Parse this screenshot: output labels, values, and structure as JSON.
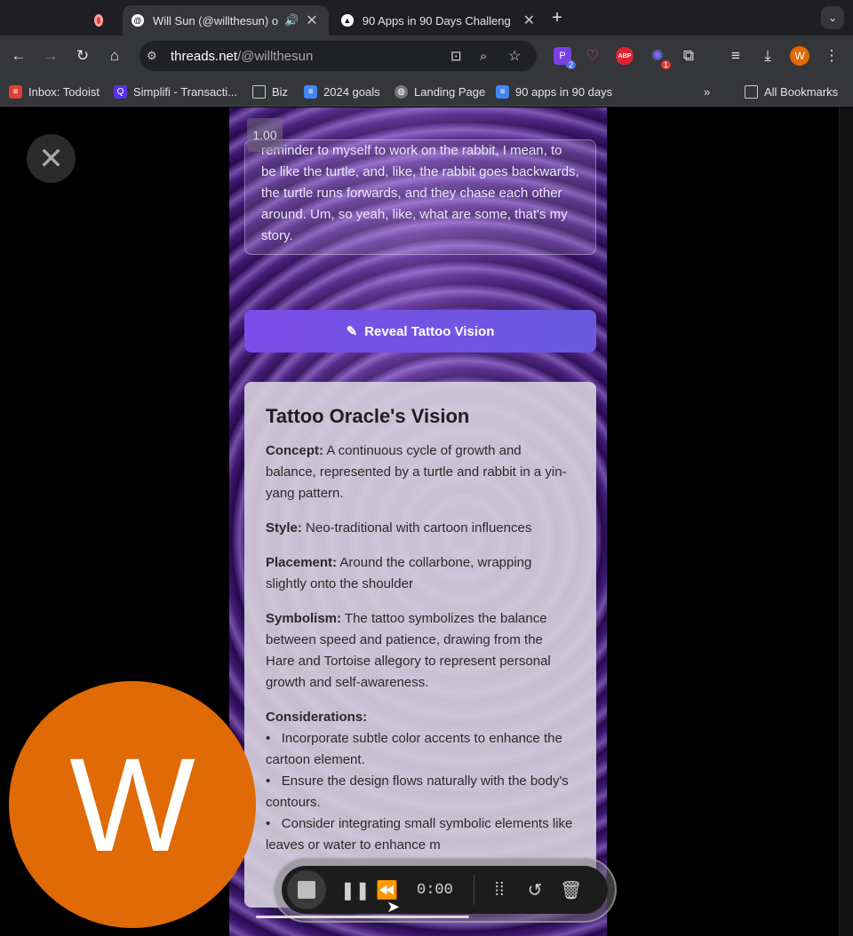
{
  "browser": {
    "tabs": [
      {
        "title": "",
        "icon": "recording-icon"
      },
      {
        "title": "Will Sun (@willthesun) on",
        "icon": "threads-icon",
        "active": true
      },
      {
        "title": "90 Apps in 90 Days Challeng",
        "icon": "triangle-icon"
      }
    ],
    "url_host": "threads.net",
    "url_path": "/@willthesun",
    "bookmarks": [
      {
        "label": "Inbox: Todoist",
        "color": "#db4035"
      },
      {
        "label": "Simplifi - Transacti...",
        "color": "#5a32e6"
      },
      {
        "label": "Biz",
        "color": "folder"
      },
      {
        "label": "2024 goals",
        "color": "#4285f4"
      },
      {
        "label": "Landing Page",
        "color": "globe"
      },
      {
        "label": "90 apps in 90 days",
        "color": "#4285f4"
      }
    ],
    "all_bookmarks": "All Bookmarks",
    "profile_initial": "W",
    "ext_badge_1": "2",
    "ext_badge_2": "1",
    "abp": "ABP"
  },
  "app": {
    "speed": "1.00",
    "transcript": "reminder to myself to work on the rabbit, I mean, to be like the turtle, and, like, the rabbit goes backwards, the turtle runs forwards, and they chase each other around. Um, so yeah, like, what are some, that's my story.",
    "reveal_button": "Reveal Tattoo Vision",
    "vision": {
      "title": "Tattoo Oracle's Vision",
      "concept_label": "Concept:",
      "concept": " A continuous cycle of growth and balance, represented by a turtle and rabbit in a yin-yang pattern.",
      "style_label": "Style:",
      "style": " Neo-traditional with cartoon influences",
      "placement_label": "Placement:",
      "placement": " Around the collarbone, wrapping slightly onto the shoulder",
      "symbolism_label": "Symbolism:",
      "symbolism": " The tattoo symbolizes the balance between speed and patience, drawing from the Hare and Tortoise allegory to represent personal growth and self-awareness.",
      "considerations_label": "Considerations:",
      "considerations": [
        "Incorporate subtle color accents to enhance the cartoon element.",
        "Ensure the design flows naturally with the body's contours.",
        "Consider integrating small symbolic elements like leaves or water to enhance m"
      ]
    }
  },
  "overlay": {
    "avatar_letter": "W",
    "avatar_color": "#e06a05",
    "recorder_time": "0:00",
    "progress": 0.33
  }
}
